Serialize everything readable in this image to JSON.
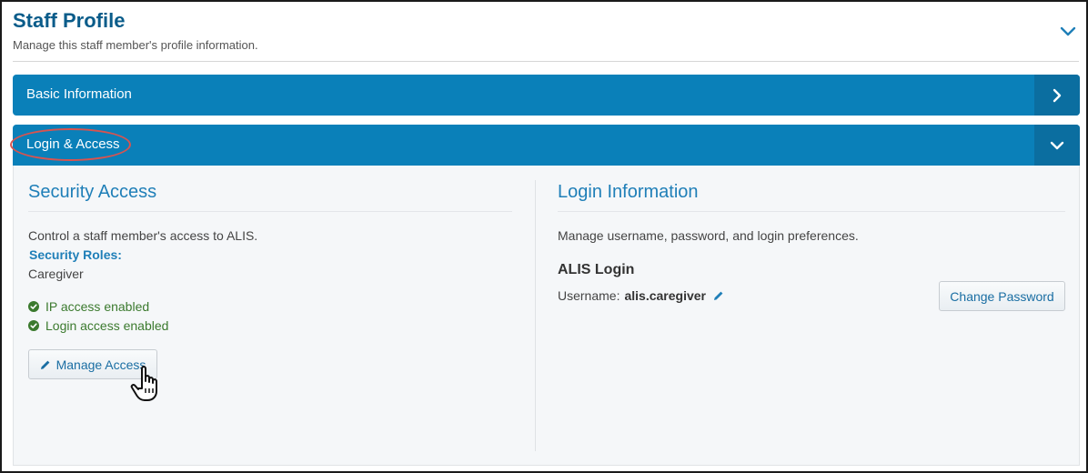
{
  "header": {
    "title": "Staff Profile",
    "subtitle": "Manage this staff member's profile information."
  },
  "accordions": {
    "basic": {
      "label": "Basic Information",
      "state": "collapsed"
    },
    "login": {
      "label": "Login & Access",
      "state": "expanded"
    }
  },
  "security": {
    "title": "Security Access",
    "description": "Control a staff member's access to ALIS.",
    "roles_label": "Security Roles:",
    "roles_value": "Caregiver",
    "statuses": [
      "IP access enabled",
      "Login access enabled"
    ],
    "manage_button": "Manage Access"
  },
  "login_info": {
    "title": "Login Information",
    "description": "Manage username, password, and login preferences.",
    "alis_login_title": "ALIS Login",
    "username_label": "Username:",
    "username_value": "alis.caregiver",
    "change_password_button": "Change Password"
  },
  "colors": {
    "accent": "#0a80b9",
    "title_blue": "#0a5c8a",
    "status_green": "#3b7a2e",
    "annotation_red": "#d9534f"
  },
  "icons": [
    "chevron-down-icon",
    "chevron-right-icon",
    "check-circle-icon",
    "pencil-icon",
    "hand-cursor-icon"
  ]
}
